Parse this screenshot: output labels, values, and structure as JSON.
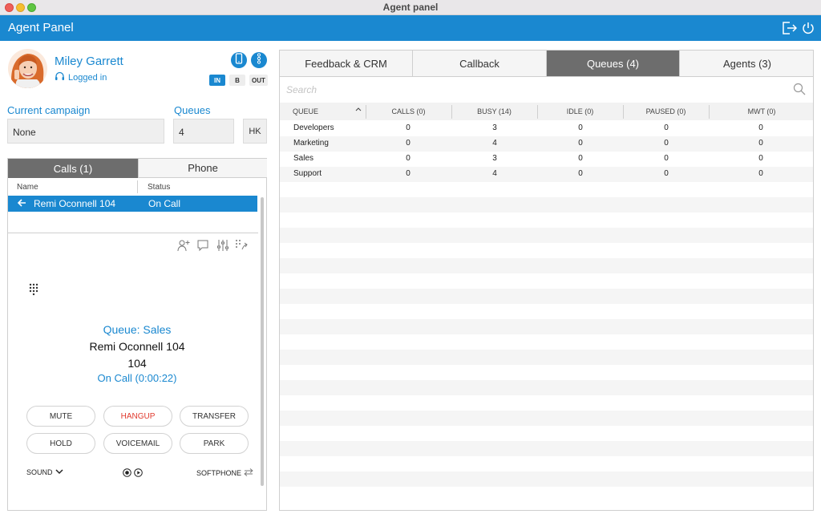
{
  "window": {
    "title": "Agent panel"
  },
  "app": {
    "title": "Agent Panel"
  },
  "agent": {
    "name": "Miley Garrett",
    "status": "Logged in"
  },
  "modes": {
    "in": "IN",
    "b": "B",
    "out": "OUT"
  },
  "campaign": {
    "label": "Current campaign",
    "value": "None"
  },
  "queues": {
    "label": "Queues",
    "value": "4",
    "hk": "HK"
  },
  "calls_panel": {
    "tabs": [
      "Calls (1)",
      "Phone"
    ],
    "columns": [
      "Name",
      "Status"
    ],
    "rows": [
      {
        "name": "Remi Oconnell 104",
        "status": "On Call"
      }
    ]
  },
  "active_call": {
    "queue": "Queue: Sales",
    "caller": "Remi Oconnell 104",
    "number": "104",
    "status": "On Call (0:00:22)"
  },
  "call_buttons": [
    "MUTE",
    "HANGUP",
    "TRANSFER",
    "HOLD",
    "VOICEMAIL",
    "PARK"
  ],
  "call_footer": {
    "sound": "SOUND",
    "softphone": "SOFTPHONE"
  },
  "right_tabs": [
    "Feedback & CRM",
    "Callback",
    "Queues (4)",
    "Agents (3)"
  ],
  "search": {
    "placeholder": "Search"
  },
  "queue_table": {
    "headers": [
      "QUEUE",
      "CALLS (0)",
      "BUSY (14)",
      "IDLE (0)",
      "PAUSED (0)",
      "MWT (0)"
    ],
    "rows": [
      [
        "Developers",
        "0",
        "3",
        "0",
        "0",
        "0"
      ],
      [
        "Marketing",
        "0",
        "4",
        "0",
        "0",
        "0"
      ],
      [
        "Sales",
        "0",
        "3",
        "0",
        "0",
        "0"
      ],
      [
        "Support",
        "0",
        "4",
        "0",
        "0",
        "0"
      ]
    ]
  },
  "colors": {
    "accent": "#1a88d0",
    "active_tab": "#6d6d6d",
    "hangup": "#e03a2e"
  }
}
